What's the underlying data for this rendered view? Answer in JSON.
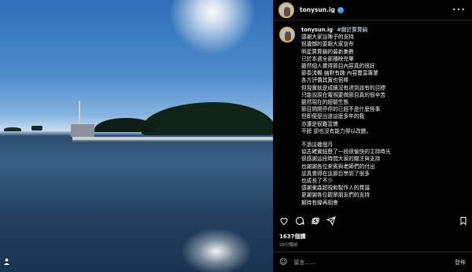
{
  "colors": {
    "accent": "#3897f0",
    "background": "#000000"
  },
  "header": {
    "username": "tonysun.ig",
    "verified_icon": "verified-badge-icon",
    "more_icon": "more-options-icon"
  },
  "caption": {
    "username": "tonysun.ig",
    "tag": "#關於算算鍋",
    "lines_part1": [
      "感謝大家這陣子的支持",
      "很遺憾的要跟大家宣布",
      "明星算算鍋的最新集數",
      "已於本週全部播映完畢",
      "雖然個人覺得節目內容真的很好",
      "節奏流暢 幽默有趣 內容豐富專業",
      "各方評價其實也很棒",
      "但現實就是成績沒有達到該有的目標",
      "只能說現在電視要做節目真的很辛苦",
      "雖然現在的經驗生態",
      "節目開開停停的已經不是什麼怪事",
      "但即便是出道這麼多年的我",
      "亦還是很難習慣",
      "不膀 卻也沒有能力得以改變。"
    ],
    "lines_part2": [
      "不過這幾個月",
      "協志確實經歷了一段很愉快的主持時光",
      "很感謝這段時間大家的關注與支持",
      "也謝謝各位來賓與老師們的付出",
      "認真覺得在這節目學到了很多",
      "也成長了不少",
      "感謝東森超視和製作人的賞識",
      "更謝謝各位觀眾朋友們的支持",
      "期待有緣再相會"
    ]
  },
  "actions": {
    "like_icon": "heart-icon",
    "comment_icon": "comment-icon",
    "repost_icon": "repost-icon",
    "share_icon": "share-icon",
    "save_icon": "bookmark-icon"
  },
  "stats": {
    "likes": "1637個讚",
    "time_ago": "28分鐘前"
  },
  "comment": {
    "placeholder": "留言……",
    "post_label": "發佈"
  }
}
